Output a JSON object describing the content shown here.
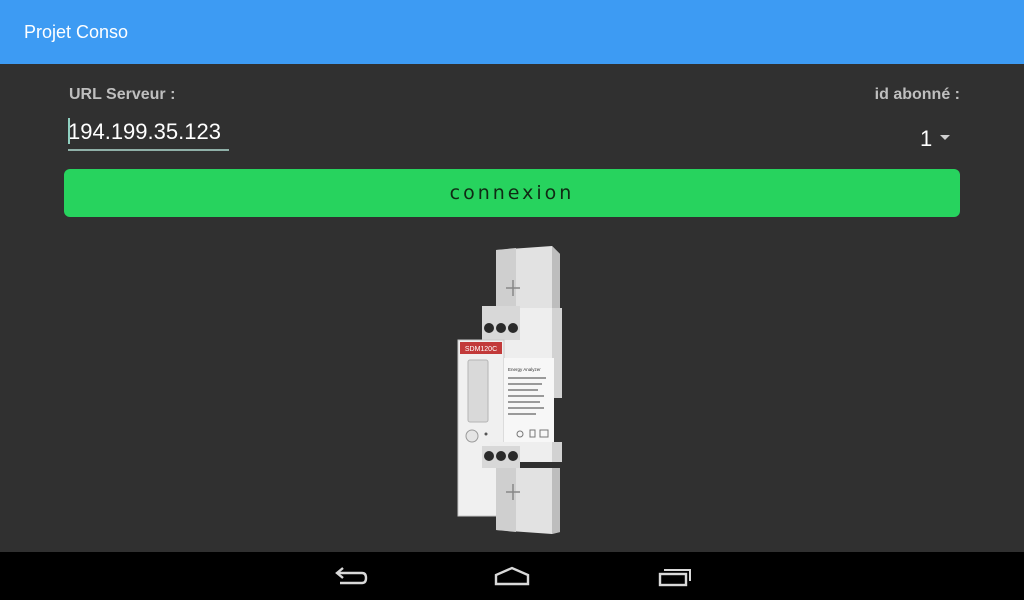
{
  "app_bar": {
    "title": "Projet Conso"
  },
  "form": {
    "url_label": "URL Serveur :",
    "url_value": "194.199.35.123",
    "id_label": "id abonné :",
    "id_value": "1",
    "connect_button_label": "connexion"
  },
  "meter_image": {
    "model_label": "SDM120C",
    "title_label": "Energy Analyzer"
  },
  "nav_bar": {
    "icons": [
      "back-icon",
      "home-icon",
      "recent-apps-icon"
    ]
  },
  "colors": {
    "app_bar": "#3d9bf3",
    "background": "#303030",
    "button": "#27d35e",
    "nav_bar": "#000000"
  }
}
